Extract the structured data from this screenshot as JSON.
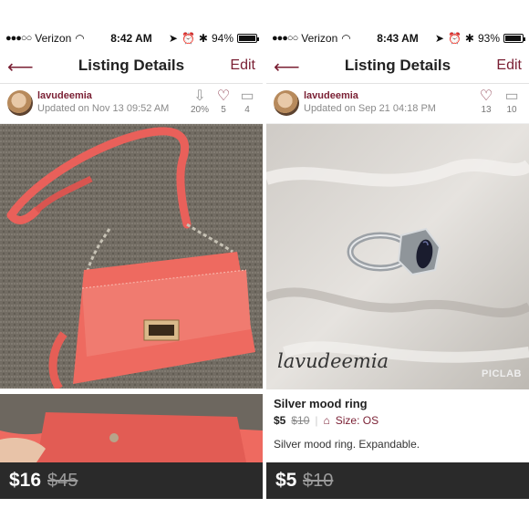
{
  "left": {
    "status": {
      "carrier": "Verizon",
      "time": "8:42 AM",
      "battery": "94%",
      "battery_level": 0.94
    },
    "nav": {
      "title": "Listing Details",
      "edit": "Edit"
    },
    "user": {
      "name": "lavudeemia",
      "updated": "Updated on Nov 13 09:52 AM"
    },
    "stats": {
      "discount": "20%",
      "likes": "5",
      "comments": "4"
    },
    "price": {
      "current": "$16",
      "original": "$45"
    }
  },
  "right": {
    "status": {
      "carrier": "Verizon",
      "time": "8:43 AM",
      "battery": "93%",
      "battery_level": 0.93
    },
    "nav": {
      "title": "Listing Details",
      "edit": "Edit"
    },
    "user": {
      "name": "lavudeemia",
      "updated": "Updated on Sep 21 04:18 PM"
    },
    "stats": {
      "likes": "13",
      "comments": "10"
    },
    "photo": {
      "signature": "lavudeemia",
      "watermark": "PICLAB"
    },
    "item": {
      "title": "Silver mood ring",
      "price": "$5",
      "original": "$10",
      "size": "Size: OS",
      "description": "Silver mood ring. Expandable."
    },
    "price": {
      "current": "$5",
      "original": "$10"
    }
  },
  "colors": {
    "accent": "#7a1f33",
    "price_bar": "#2a2a2a"
  },
  "icons": [
    "back-arrow-icon",
    "price-drop-icon",
    "heart-icon",
    "comment-icon",
    "hanger-icon",
    "wifi-icon",
    "alarm-icon",
    "location-icon",
    "bluetooth-icon",
    "battery-icon"
  ]
}
